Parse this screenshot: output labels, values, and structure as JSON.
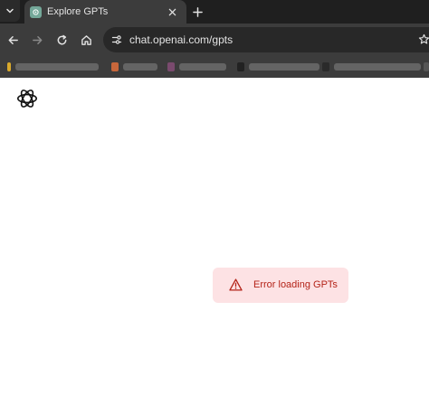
{
  "tabs": [
    {
      "title": "Explore GPTs",
      "favicon": "openai-favicon-icon",
      "active": true
    }
  ],
  "toolbar": {
    "url": "chat.openai.com/gpts",
    "buttons": [
      "back-icon",
      "forward-icon",
      "reload-icon",
      "home-icon",
      "site-info-icon",
      "bookmark-star-icon"
    ]
  },
  "bookmarks": {
    "note": "labels are blurred in the screenshot"
  },
  "page": {
    "logo": "openai-logo-icon",
    "error": {
      "message": "Error loading GPTs",
      "icon": "warning-icon"
    }
  },
  "colors": {
    "tabstrip_bg": "#1f1f1f",
    "toolbar_bg": "#3c3c3c",
    "error_bg": "#fde2e4",
    "error_text": "#b42318"
  }
}
